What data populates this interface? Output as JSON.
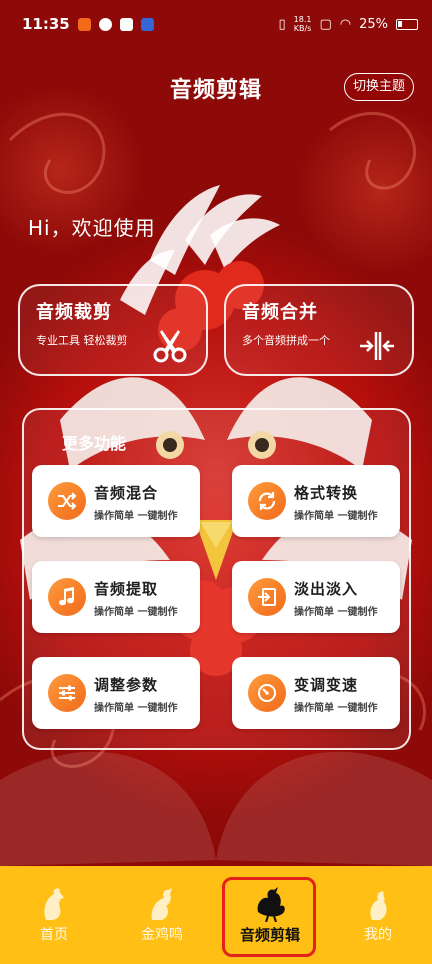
{
  "status_bar": {
    "time": "11:35",
    "speed_top": "18.1",
    "speed_bottom": "KB/s",
    "battery": "25%"
  },
  "header": {
    "title": "音频剪辑",
    "theme_button": "切换主题"
  },
  "greeting": "Hi，欢迎使用",
  "cards": {
    "trim": {
      "title": "音频裁剪",
      "subtitle": "专业工具  轻松裁剪",
      "icon": "scissors-icon"
    },
    "merge": {
      "title": "音频合并",
      "subtitle": "多个音频拼成一个",
      "icon": "merge-icon"
    }
  },
  "more": {
    "title": "更多功能",
    "items": [
      {
        "name": "音频混合",
        "desc": "操作简单  一键制作",
        "icon": "shuffle-icon"
      },
      {
        "name": "格式转换",
        "desc": "操作简单  一键制作",
        "icon": "refresh-icon"
      },
      {
        "name": "音频提取",
        "desc": "操作简单  一键制作",
        "icon": "music-note-icon"
      },
      {
        "name": "淡出淡入",
        "desc": "操作简单  一键制作",
        "icon": "import-icon"
      },
      {
        "name": "调整参数",
        "desc": "操作简单  一键制作",
        "icon": "sliders-icon"
      },
      {
        "name": "变调变速",
        "desc": "操作简单  一键制作",
        "icon": "speed-icon"
      }
    ]
  },
  "bottom_nav": {
    "items": [
      {
        "label": "首页",
        "icon": "rooster-home-icon"
      },
      {
        "label": "金鸡鸣",
        "icon": "rooster-crow-icon"
      },
      {
        "label": "音频剪辑",
        "icon": "rooster-active-icon"
      },
      {
        "label": "我的",
        "icon": "rooster-profile-icon"
      }
    ],
    "active_index": 2
  },
  "colors": {
    "background": "#c8140f",
    "nav_background": "#ffbf14",
    "icon_gradient_start": "#ff9a3c",
    "icon_gradient_end": "#f06a1a",
    "highlight_border": "#e3221b"
  }
}
